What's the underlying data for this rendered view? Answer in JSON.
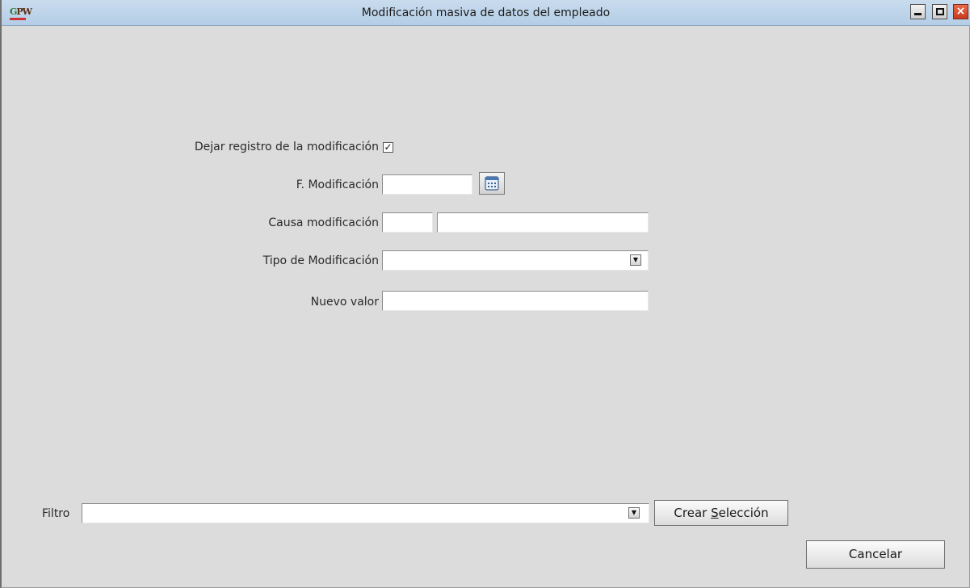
{
  "window": {
    "title": "Modificación masiva de datos del empleado",
    "app_icon": "GPW"
  },
  "form": {
    "dejar_registro": {
      "label": "Dejar registro de la modificación",
      "checked": true,
      "check_glyph": "✓"
    },
    "f_modificacion": {
      "label": "F. Modificación",
      "value": "",
      "icon": "calendar-icon"
    },
    "causa_modificacion": {
      "label": "Causa modificación",
      "code_value": "",
      "description_value": ""
    },
    "tipo_modificacion": {
      "label": "Tipo de Modificación",
      "value": ""
    },
    "nuevo_valor": {
      "label": "Nuevo valor",
      "value": ""
    }
  },
  "filter": {
    "label": "Filtro",
    "value": "",
    "create_selection_button": {
      "prefix": "Crear ",
      "mnemonic": "S",
      "suffix": "elección"
    }
  },
  "actions": {
    "cancel_label": "Cancelar"
  }
}
